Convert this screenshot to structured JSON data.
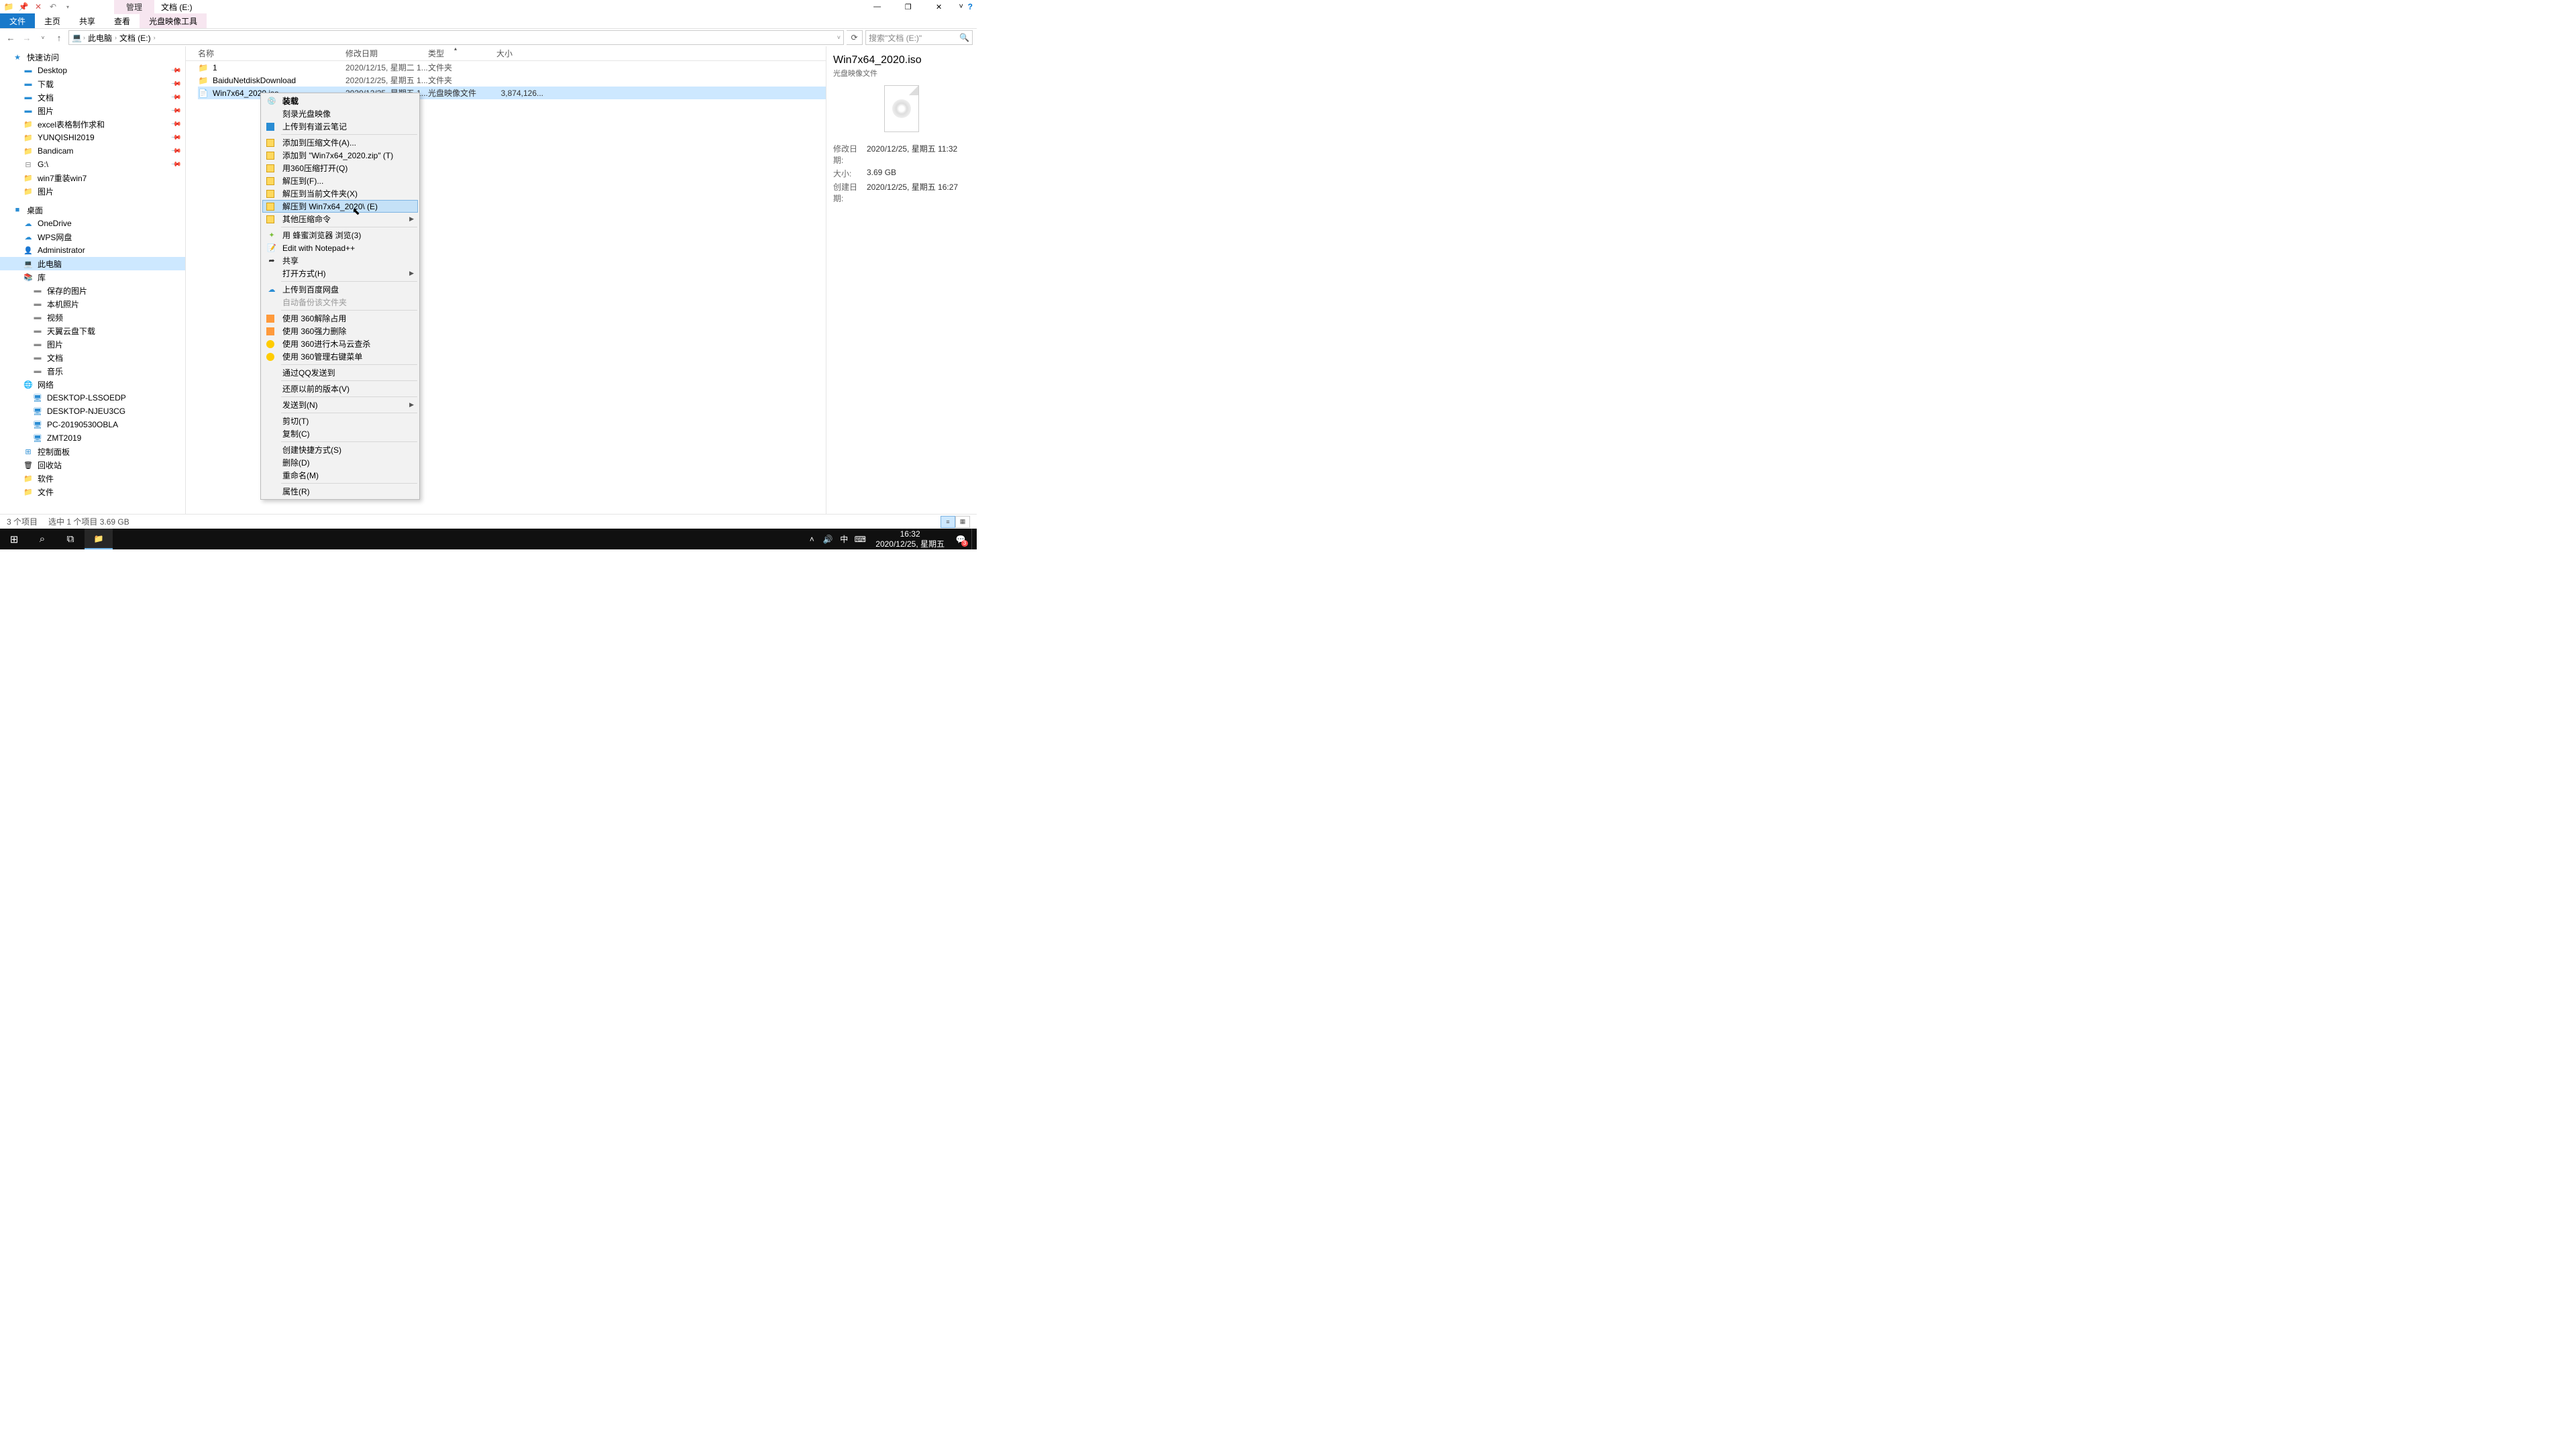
{
  "window": {
    "title_context_tab": "管理",
    "title_drive": "文档 (E:)"
  },
  "ribbon": {
    "file": "文件",
    "home": "主页",
    "share": "共享",
    "view": "查看",
    "contextual": "光盘映像工具"
  },
  "nav": {
    "this_pc": "此电脑",
    "drive": "文档 (E:)"
  },
  "search": {
    "placeholder": "搜索\"文档 (E:)\""
  },
  "sidebar": {
    "quick_access": "快速访问",
    "items_qa": [
      {
        "label": "Desktop",
        "icon": "blue"
      },
      {
        "label": "下载",
        "icon": "blue"
      },
      {
        "label": "文档",
        "icon": "blue"
      },
      {
        "label": "图片",
        "icon": "blue"
      },
      {
        "label": "excel表格制作求和",
        "icon": "folder"
      },
      {
        "label": "YUNQISHI2019",
        "icon": "folder"
      },
      {
        "label": "Bandicam",
        "icon": "folder"
      },
      {
        "label": "G:\\",
        "icon": "disk"
      },
      {
        "label": "win7重装win7",
        "icon": "folder"
      },
      {
        "label": "图片",
        "icon": "folder"
      }
    ],
    "desktop": "桌面",
    "items_desktop": [
      {
        "label": "OneDrive",
        "icon": "cloud"
      },
      {
        "label": "WPS网盘",
        "icon": "cloud"
      },
      {
        "label": "Administrator",
        "icon": "user"
      },
      {
        "label": "此电脑",
        "icon": "pc",
        "sel": true
      },
      {
        "label": "库",
        "icon": "lib"
      }
    ],
    "items_lib": [
      {
        "label": "保存的图片"
      },
      {
        "label": "本机照片"
      },
      {
        "label": "视频"
      },
      {
        "label": "天翼云盘下载"
      },
      {
        "label": "图片"
      },
      {
        "label": "文档"
      },
      {
        "label": "音乐"
      }
    ],
    "network": "网络",
    "items_net": [
      {
        "label": "DESKTOP-LSSOEDP"
      },
      {
        "label": "DESKTOP-NJEU3CG"
      },
      {
        "label": "PC-20190530OBLA"
      },
      {
        "label": "ZMT2019"
      }
    ],
    "control_panel": "控制面板",
    "recycle": "回收站",
    "software": "软件",
    "files": "文件"
  },
  "columns": {
    "name": "名称",
    "date": "修改日期",
    "type": "类型",
    "size": "大小"
  },
  "rows": [
    {
      "name": "1",
      "date": "2020/12/15, 星期二 1...",
      "type": "文件夹",
      "size": "",
      "icon": "folder"
    },
    {
      "name": "BaiduNetdiskDownload",
      "date": "2020/12/25, 星期五 1...",
      "type": "文件夹",
      "size": "",
      "icon": "folder"
    },
    {
      "name": "Win7x64_2020.iso",
      "date": "2020/12/25, 星期五 1...",
      "type": "光盘映像文件",
      "size": "3,874,126...",
      "icon": "iso",
      "sel": true
    }
  ],
  "details": {
    "title": "Win7x64_2020.iso",
    "subtitle": "光盘映像文件",
    "modified_k": "修改日期:",
    "modified_v": "2020/12/25, 星期五 11:32",
    "size_k": "大小:",
    "size_v": "3.69 GB",
    "created_k": "创建日期:",
    "created_v": "2020/12/25, 星期五 16:27"
  },
  "context_menu": [
    {
      "label": "装载",
      "icon": "disc",
      "bold": true
    },
    {
      "label": "刻录光盘映像"
    },
    {
      "label": "上传到有道云笔记",
      "icon": "blue"
    },
    {
      "sep": true
    },
    {
      "label": "添加到压缩文件(A)...",
      "icon": "zip"
    },
    {
      "label": "添加到 \"Win7x64_2020.zip\" (T)",
      "icon": "zip"
    },
    {
      "label": "用360压缩打开(Q)",
      "icon": "zip"
    },
    {
      "label": "解压到(F)...",
      "icon": "zip"
    },
    {
      "label": "解压到当前文件夹(X)",
      "icon": "zip"
    },
    {
      "label": "解压到 Win7x64_2020\\ (E)",
      "icon": "zip",
      "hover": true
    },
    {
      "label": "其他压缩命令",
      "icon": "zip",
      "sub": true
    },
    {
      "sep": true
    },
    {
      "label": "用 蜂蜜浏览器 浏览(3)",
      "icon": "green-dot"
    },
    {
      "label": "Edit with Notepad++",
      "icon": "npp"
    },
    {
      "label": "共享",
      "icon": "share"
    },
    {
      "label": "打开方式(H)",
      "sub": true
    },
    {
      "sep": true
    },
    {
      "label": "上传到百度网盘",
      "icon": "baidu"
    },
    {
      "label": "自动备份该文件夹",
      "disabled": true
    },
    {
      "sep": true
    },
    {
      "label": "使用 360解除占用",
      "icon": "y360"
    },
    {
      "label": "使用 360强力删除",
      "icon": "y360p"
    },
    {
      "label": "使用 360进行木马云查杀",
      "icon": "y360g"
    },
    {
      "label": "使用 360管理右键菜单",
      "icon": "y360g"
    },
    {
      "sep": true
    },
    {
      "label": "通过QQ发送到"
    },
    {
      "sep": true
    },
    {
      "label": "还原以前的版本(V)"
    },
    {
      "sep": true
    },
    {
      "label": "发送到(N)",
      "sub": true
    },
    {
      "sep": true
    },
    {
      "label": "剪切(T)"
    },
    {
      "label": "复制(C)"
    },
    {
      "sep": true
    },
    {
      "label": "创建快捷方式(S)"
    },
    {
      "label": "删除(D)"
    },
    {
      "label": "重命名(M)"
    },
    {
      "sep": true
    },
    {
      "label": "属性(R)"
    }
  ],
  "status": {
    "count": "3 个项目",
    "selection": "选中 1 个项目  3.69 GB"
  },
  "taskbar": {
    "time": "16:32",
    "date": "2020/12/25, 星期五",
    "ime": "中",
    "notif_count": "3"
  }
}
